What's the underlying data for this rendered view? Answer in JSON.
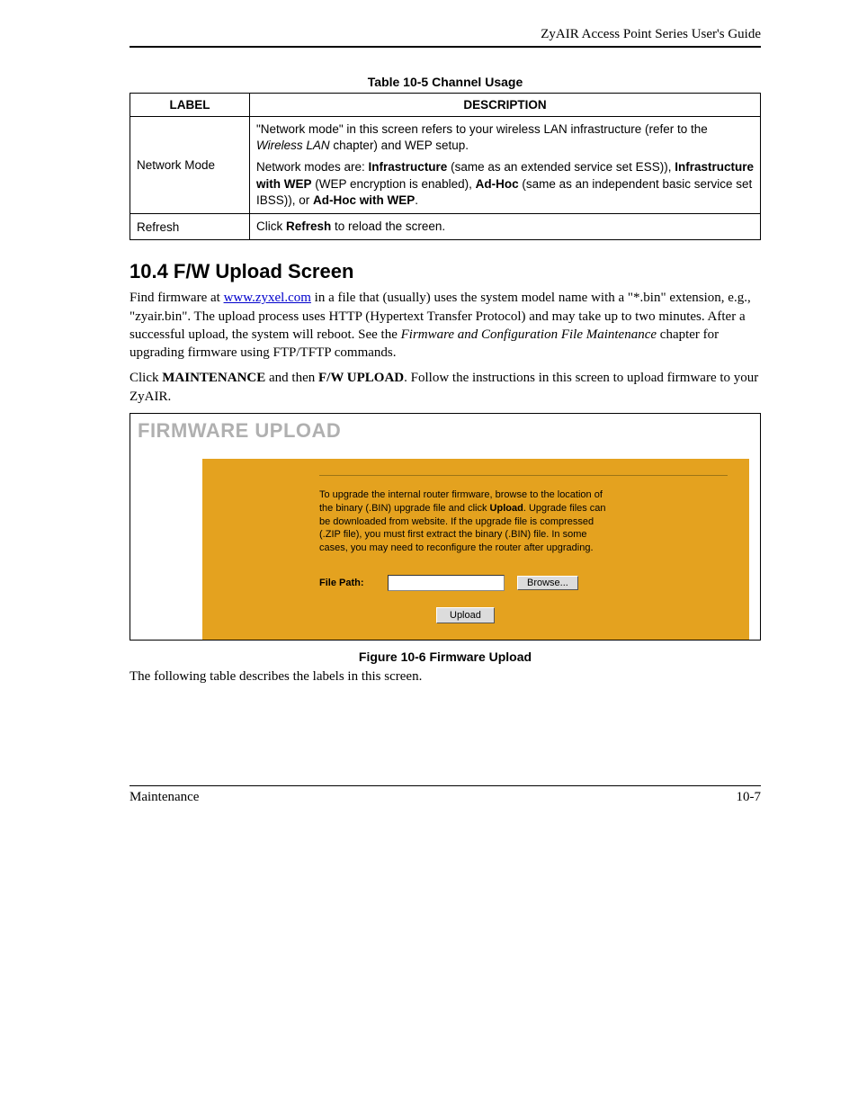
{
  "header": {
    "title": "ZyAIR Access Point Series User's Guide"
  },
  "table": {
    "caption": "Table 10-5 Channel Usage",
    "headers": {
      "label": "LABEL",
      "description": "DESCRIPTION"
    },
    "rows": [
      {
        "label": "Network Mode",
        "desc_p1_a": "\"Network mode\" in this screen refers to your wireless LAN infrastructure (refer to the ",
        "desc_p1_i": "Wireless LAN",
        "desc_p1_b": " chapter) and WEP setup.",
        "desc_p2_a": "Network modes are: ",
        "desc_p2_b1": "Infrastructure",
        "desc_p2_c": " (same as an extended service set ESS)), ",
        "desc_p2_b2": "Infrastructure with WEP",
        "desc_p2_d": " (WEP encryption is enabled), ",
        "desc_p2_b3": "Ad-Hoc",
        "desc_p2_e": " (same as an independent basic service set IBSS)), or ",
        "desc_p2_b4": "Ad-Hoc with WEP",
        "desc_p2_f": "."
      },
      {
        "label": "Refresh",
        "desc_a": "Click ",
        "desc_b": "Refresh",
        "desc_c": " to reload the screen."
      }
    ]
  },
  "section": {
    "heading": "10.4  F/W Upload Screen",
    "p1_a": "Find firmware at ",
    "p1_link": "www.zyxel.com",
    "p1_b": " in a file that (usually) uses the system model name with a \"*.bin\" extension, e.g., \"zyair.bin\". The upload process uses HTTP (Hypertext Transfer Protocol) and may take up to two minutes. After a successful upload, the system will reboot.  See the ",
    "p1_i": "Firmware and Configuration File Maintenance",
    "p1_c": " chapter for upgrading firmware using FTP/TFTP commands.",
    "p2_a": "Click ",
    "p2_b1": "MAINTENANCE",
    "p2_b": " and then ",
    "p2_b2": "F/W UPLOAD",
    "p2_c": ". Follow the instructions in this screen to upload firmware to your ZyAIR."
  },
  "screenshot": {
    "title": "FIRMWARE UPLOAD",
    "instr_a": "To upgrade the internal router firmware, browse to the location of the binary (.BIN) upgrade file and click ",
    "instr_b": "Upload",
    "instr_c": ". Upgrade files can be downloaded from website. If the upgrade file is compressed (.ZIP file), you must first extract the binary (.BIN) file. In some cases, you may need to reconfigure the router after upgrading.",
    "filepath_label": "File Path:",
    "browse_label": "Browse...",
    "upload_label": "Upload"
  },
  "figure_caption": "Figure 10-6 Firmware Upload",
  "after_figure": "The following table describes the labels in this screen.",
  "footer": {
    "left": "Maintenance",
    "right": "10-7"
  }
}
